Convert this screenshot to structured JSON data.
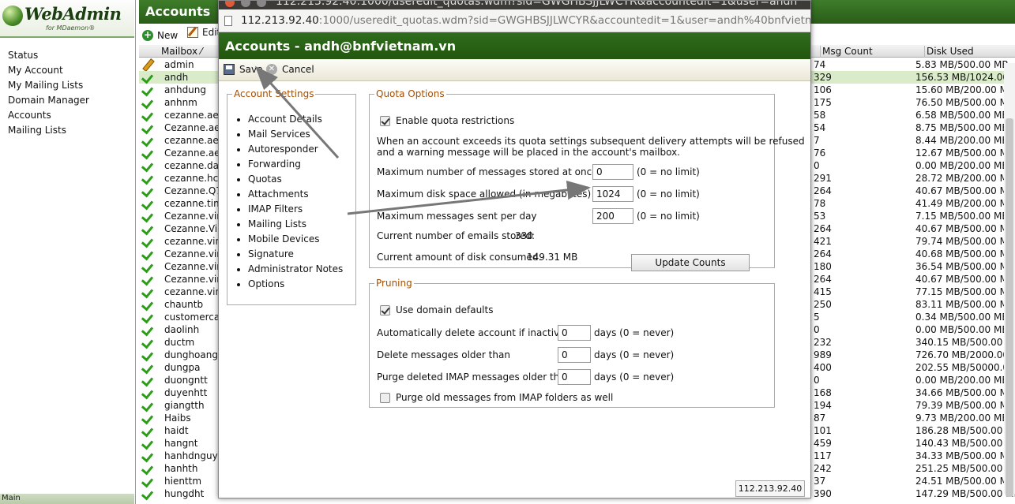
{
  "logo": {
    "name": "WebAdmin",
    "sub": "for MDaemon®"
  },
  "nav": [
    "Status",
    "My Account",
    "My Mailing Lists",
    "Domain Manager",
    "Accounts",
    "Mailing Lists"
  ],
  "left_footer": "Main",
  "main": {
    "title": "Accounts",
    "new_label": "New",
    "edit_label": "Edit",
    "columns": {
      "mailbox": "Mailbox ⁄",
      "msg_count": "Msg Count",
      "disk_used": "Disk Used"
    },
    "rows": [
      {
        "name": "admin",
        "count": "74",
        "disk": "5.83 MB/500.00 MB",
        "icon": "pencil"
      },
      {
        "name": "andh",
        "count": "329",
        "disk": "156.53 MB/1024.00 MB",
        "selected": true
      },
      {
        "name": "anhdung",
        "count": "106",
        "disk": "15.60 MB/200.00 MB"
      },
      {
        "name": "anhnm",
        "count": "175",
        "disk": "76.50 MB/500.00 MB"
      },
      {
        "name": "cezanne.aeon",
        "count": "58",
        "disk": "6.58 MB/500.00 MB"
      },
      {
        "name": "Cezanne.aeon",
        "count": "54",
        "disk": "8.75 MB/500.00 MB"
      },
      {
        "name": "cezanne.aeon",
        "count": "7",
        "disk": "8.44 MB/200.00 MB"
      },
      {
        "name": "Cezanne.aeon",
        "count": "76",
        "disk": "12.67 MB/500.00 MB"
      },
      {
        "name": "cezanne.dana",
        "count": "0",
        "disk": "0.00 MB/200.00 MB"
      },
      {
        "name": "cezanne.hcm",
        "count": "291",
        "disk": "28.72 MB/200.00 MB"
      },
      {
        "name": "Cezanne.Q7",
        "count": "264",
        "disk": "40.67 MB/500.00 MB"
      },
      {
        "name": "cezanne.time",
        "count": "78",
        "disk": "41.49 MB/200.00 MB"
      },
      {
        "name": "Cezanne.vinc",
        "count": "53",
        "disk": "7.15 MB/500.00 MB"
      },
      {
        "name": "Cezanne.Vinc",
        "count": "264",
        "disk": "40.67 MB/500.00 MB"
      },
      {
        "name": "cezanne.vinc",
        "count": "421",
        "disk": "79.74 MB/500.00 MB"
      },
      {
        "name": "Cezanne.vinc",
        "count": "264",
        "disk": "40.68 MB/500.00 MB"
      },
      {
        "name": "Cezanne.vinc",
        "count": "180",
        "disk": "36.54 MB/500.00 MB"
      },
      {
        "name": "Cezanne.vinc",
        "count": "264",
        "disk": "40.67 MB/500.00 MB"
      },
      {
        "name": "cezanne.vinc",
        "count": "415",
        "disk": "77.15 MB/500.00 MB"
      },
      {
        "name": "chauntb",
        "count": "250",
        "disk": "83.11 MB/500.00 MB"
      },
      {
        "name": "customercare",
        "count": "5",
        "disk": "0.34 MB/500.00 MB"
      },
      {
        "name": "daolinh",
        "count": "0",
        "disk": "0.00 MB/500.00 MB"
      },
      {
        "name": "ductm",
        "count": "232",
        "disk": "340.15 MB/500.00 MB"
      },
      {
        "name": "dunghoang",
        "count": "989",
        "disk": "726.70 MB/2000.00 MB"
      },
      {
        "name": "dungpa",
        "count": "400",
        "disk": "202.55 MB/50000.00 MB"
      },
      {
        "name": "duongntt",
        "count": "0",
        "disk": "0.00 MB/200.00 MB"
      },
      {
        "name": "duyenhtt",
        "count": "168",
        "disk": "34.66 MB/500.00 MB"
      },
      {
        "name": "giangtth",
        "count": "194",
        "disk": "79.39 MB/500.00 MB"
      },
      {
        "name": "Haibs",
        "count": "87",
        "disk": "9.73 MB/200.00 MB"
      },
      {
        "name": "haidt",
        "count": "101",
        "disk": "186.28 MB/500.00 MB"
      },
      {
        "name": "hangnt",
        "count": "459",
        "disk": "140.43 MB/500.00 MB"
      },
      {
        "name": "hanhdnguyen",
        "count": "117",
        "disk": "34.33 MB/500.00 MB"
      },
      {
        "name": "hanhth",
        "count": "242",
        "disk": "251.25 MB/500.00 MB"
      },
      {
        "name": "hienttm",
        "count": "37",
        "disk": "24.51 MB/500.00 MB"
      },
      {
        "name": "hungdht",
        "count": "390",
        "disk": "147.29 MB/500.00 MB"
      }
    ]
  },
  "popup": {
    "window_title": "112.213.92.40:1000/useredit_quotas.wdm?sid=GWGHBSJJLWCYR&accountedit=1&user=andh",
    "url_host": "112.213.92.40",
    "url_rest": ":1000/useredit_quotas.wdm?sid=GWGHBSJJLWCYR&accountedit=1&user=andh%40bnfvietnam.vn",
    "header": "Accounts - andh@bnfvietnam.vn",
    "save_label": "Save",
    "cancel_label": "Cancel",
    "settings": {
      "legend": "Account Settings",
      "items": [
        "Account Details",
        "Mail Services",
        "Autoresponder",
        "Forwarding",
        "Quotas",
        "Attachments",
        "IMAP Filters",
        "Mailing Lists",
        "Mobile Devices",
        "Signature",
        "Administrator Notes",
        "Options"
      ]
    },
    "quota": {
      "legend": "Quota Options",
      "enable_label": "Enable quota restrictions",
      "enable_checked": true,
      "note1": "When an account exceeds its quota settings subsequent delivery attempts will be refused",
      "note2": "and a warning message will be placed in the account's mailbox.",
      "max_messages_label": "Maximum number of messages stored at once",
      "max_messages_value": "0",
      "max_disk_label": "Maximum disk space allowed (in megabytes)",
      "max_disk_value": "1024",
      "max_sent_label": "Maximum messages sent per day",
      "max_sent_value": "200",
      "no_limit": "(0 = no limit)",
      "current_emails_label": "Current number of emails stored:",
      "current_emails_value": "330",
      "current_disk_label": "Current amount of disk consumed:",
      "current_disk_value": "149.31 MB",
      "update_button": "Update Counts"
    },
    "pruning": {
      "legend": "Pruning",
      "domain_defaults_label": "Use domain defaults",
      "domain_defaults_checked": true,
      "inactive_label": "Automatically delete account if inactive for",
      "inactive_value": "0",
      "older_label": "Delete messages older than",
      "older_value": "0",
      "imap_label": "Purge deleted IMAP messages older than",
      "imap_value": "0",
      "days_never": "days (0 = never)",
      "purge_old_label": "Purge old messages from IMAP folders as well",
      "purge_old_checked": false
    },
    "status_ip": "112.213.92.40"
  },
  "colors": {
    "header_green": "#2f6d1c",
    "legend_orange": "#a44d00",
    "check_green": "#2b9d16",
    "selected_row": "#d9ebc9"
  }
}
